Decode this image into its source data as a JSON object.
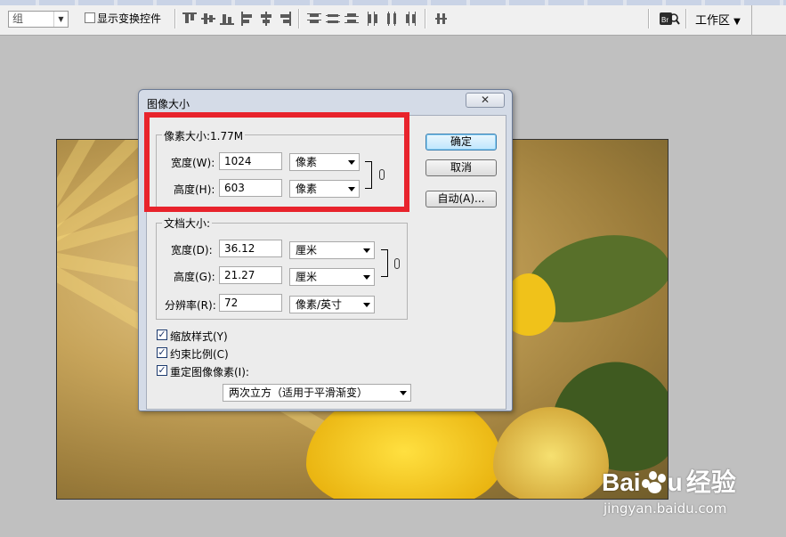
{
  "toolbar": {
    "group_select": "组",
    "show_transform_label": "显示变换控件",
    "workspace_label": "工作区"
  },
  "dialog": {
    "title": "图像大小",
    "close_glyph": "✕",
    "pixel_dimensions": {
      "legend": "像素大小:1.77M",
      "width_label": "宽度(W):",
      "width_value": "1024",
      "width_unit": "像素",
      "height_label": "高度(H):",
      "height_value": "603",
      "height_unit": "像素"
    },
    "document_size": {
      "legend": "文档大小:",
      "width_label": "宽度(D):",
      "width_value": "36.12",
      "width_unit": "厘米",
      "height_label": "高度(G):",
      "height_value": "21.27",
      "height_unit": "厘米",
      "resolution_label": "分辨率(R):",
      "resolution_value": "72",
      "resolution_unit": "像素/英寸"
    },
    "options": {
      "scale_styles": "缩放样式(Y)",
      "constrain_proportions": "约束比例(C)",
      "resample": "重定图像像素(I):",
      "resample_method": "两次立方（适用于平滑渐变）",
      "check_glyph": "✓"
    },
    "buttons": {
      "ok": "确定",
      "cancel": "取消",
      "auto": "自动(A)..."
    }
  },
  "watermark": {
    "brand_prefix": "Bai",
    "brand_suffix": "u",
    "brand_cn": "经验",
    "url": "jingyan.baidu.com"
  },
  "colors": {
    "highlight": "#e8232c",
    "default_button": "#bee6fd"
  }
}
